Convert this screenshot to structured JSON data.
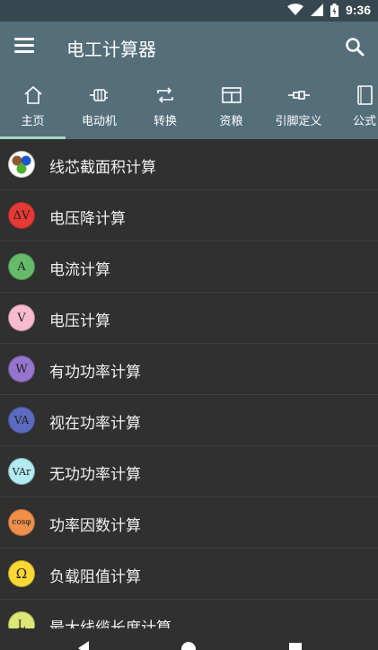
{
  "status_bar": {
    "time": "9:36"
  },
  "app_bar": {
    "title": "电工计算器"
  },
  "tabs": [
    {
      "label": "主页",
      "icon": "home-icon"
    },
    {
      "label": "电动机",
      "icon": "motor-icon"
    },
    {
      "label": "转换",
      "icon": "repeat-icon"
    },
    {
      "label": "资粮",
      "icon": "table-icon"
    },
    {
      "label": "引脚定义",
      "icon": "connector-icon"
    },
    {
      "label": "公式",
      "icon": "book-icon"
    }
  ],
  "list_items": [
    {
      "label": "线芯截面积计算",
      "badge": "",
      "color": "#ffffff"
    },
    {
      "label": "电压降计算",
      "badge": "ΔV",
      "color": "#e53935"
    },
    {
      "label": "电流计算",
      "badge": "A",
      "color": "#66bb6a"
    },
    {
      "label": "电压计算",
      "badge": "V",
      "color": "#f8bbd0"
    },
    {
      "label": "有功功率计算",
      "badge": "W",
      "color": "#9575cd"
    },
    {
      "label": "视在功率计算",
      "badge": "VA",
      "color": "#5c6bc0"
    },
    {
      "label": "无功功率计算",
      "badge": "VAr",
      "color": "#b2ebf2"
    },
    {
      "label": "功率因数计算",
      "badge": "cosφ",
      "color": "#ef8f4a"
    },
    {
      "label": "负载阻值计算",
      "badge": "Ω",
      "color": "#fdd835"
    },
    {
      "label": "最大线缆长度计算",
      "badge": "L",
      "color": "#dce775"
    }
  ]
}
